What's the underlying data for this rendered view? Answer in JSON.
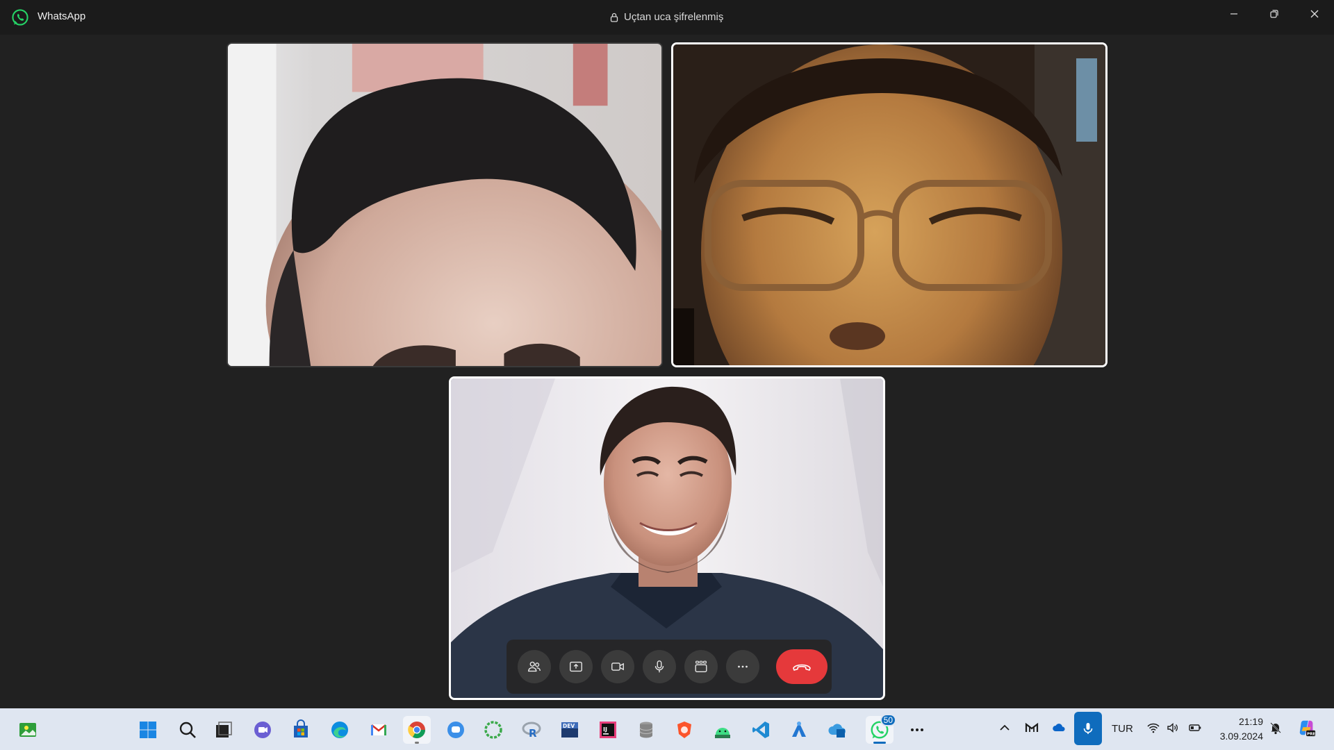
{
  "window": {
    "app_title": "WhatsApp",
    "encryption_label": "Uçtan uca şifrelenmiş",
    "minimize_icon": "minimize-icon",
    "restore_icon": "restore-icon",
    "close_icon": "close-icon"
  },
  "call": {
    "participants": [
      {
        "id": "participant-1",
        "content": "video-feed"
      },
      {
        "id": "participant-2",
        "content": "video-feed"
      },
      {
        "id": "self",
        "content": "video-feed"
      }
    ],
    "controls": [
      {
        "icon": "participants-icon"
      },
      {
        "icon": "screen-share-icon"
      },
      {
        "icon": "video-camera-icon"
      },
      {
        "icon": "microphone-icon"
      },
      {
        "icon": "layout-grid-icon"
      },
      {
        "icon": "more-options-icon"
      },
      {
        "icon": "end-call-icon"
      }
    ],
    "end_call_color": "#e5393b"
  },
  "taskbar": {
    "apps": [
      "widgets",
      "start",
      "search",
      "task-view",
      "teams-chat",
      "microsoft-store",
      "edge",
      "gmail",
      "chrome",
      "messenger",
      "loading-app",
      "r-studio",
      "dev-cpp",
      "intellij",
      "database",
      "brave",
      "android-studio",
      "vscode",
      "azure-data-studio",
      "azure",
      "whatsapp",
      "more"
    ],
    "whatsapp_badge": "50",
    "tray": {
      "language": "TUR",
      "time": "21:19",
      "date": "3.09.2024"
    }
  },
  "colors": {
    "accent": "#0f6cbd",
    "whatsapp_green": "#25d366",
    "titlebar_bg": "#1b1b1b",
    "call_bg": "#212121",
    "taskbar_bg": "#dfe6f1"
  }
}
